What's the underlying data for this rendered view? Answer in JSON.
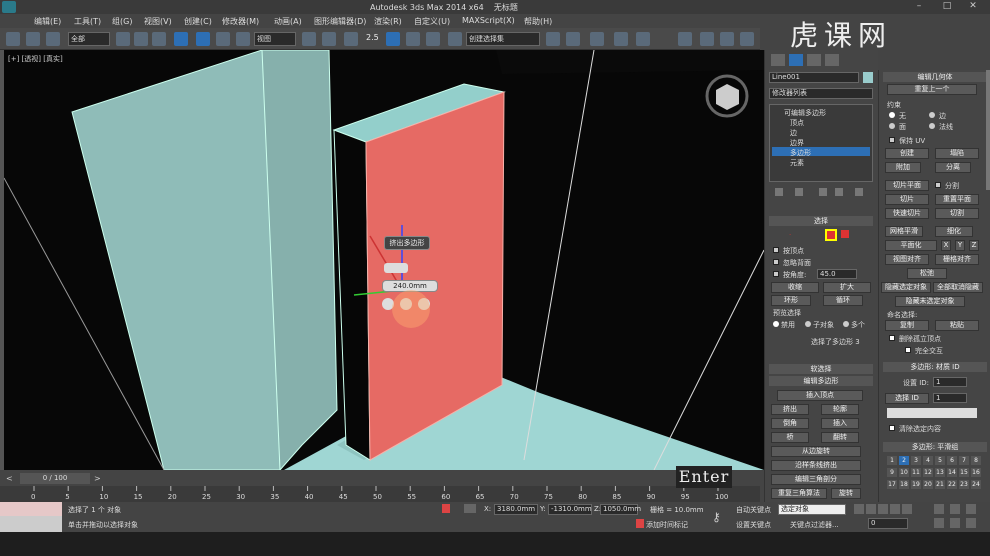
{
  "titlebar": {
    "app_title": "Autodesk 3ds Max  2014 x64",
    "doc_title": "无标题",
    "min": "–",
    "max": "□",
    "close": "✕"
  },
  "menu": [
    "编辑(E)",
    "工具(T)",
    "组(G)",
    "视图(V)",
    "创建(C)",
    "修改器(M)",
    "动画(A)",
    "图形编辑器(D)",
    "渲染(R)",
    "自定义(U)",
    "MAXScript(X)",
    "帮助(H)"
  ],
  "toolbar": {
    "filter": "全部",
    "refcoord": "视图",
    "snap": "2.5",
    "selset": "创建选择集"
  },
  "viewport": {
    "label": "[+] [透视] [真实]",
    "caddy_title": "挤出多边形",
    "caddy_value": "240.0mm"
  },
  "timeline": {
    "frame": "0 / 100",
    "ticks": [
      "0",
      "5",
      "10",
      "15",
      "20",
      "25",
      "30",
      "35",
      "40",
      "45",
      "50",
      "55",
      "60",
      "65",
      "70",
      "75",
      "80",
      "85",
      "90",
      "95",
      "100"
    ]
  },
  "status": {
    "selected": "选择了 1 个 对象",
    "hint": "单击并拖动以选择对象",
    "x": "3180.0mm",
    "y": "-1310.0mm",
    "z": "1050.0mm",
    "grid": "栅格 = 10.0mm",
    "autokey": "自动关键点",
    "setkey": "设置关键点",
    "sel_obj": "选定对象",
    "keyfilter": "关键点过滤器...",
    "addtime": "添加时间标记",
    "frame_field": "0"
  },
  "enter_overlay": "Enter",
  "watermark": "虎课网",
  "panel2": {
    "object_name": "Line001",
    "modlist": "修改器列表",
    "stack": [
      "可编辑多边形",
      "顶点",
      "边",
      "边界",
      "多边形",
      "元素"
    ],
    "select_hdr": "选择",
    "by_vertex": "按顶点",
    "ignore_back": "忽略背面",
    "by_angle": "按角度:",
    "angle_val": "45.0",
    "shrink": "收缩",
    "grow": "扩大",
    "ring": "环形",
    "loop": "循环",
    "preview_hdr": "预览选择",
    "disabled": "禁用",
    "subobj": "子对象",
    "multi": "多个",
    "sel_info": "选择了多边形 3",
    "soft_hdr": "软选择",
    "edit_poly_hdr": "编辑多边形",
    "insert_vertex": "插入顶点",
    "extrude": "挤出",
    "outline": "轮廓",
    "bevel": "倒角",
    "inset": "插入",
    "bridge": "桥",
    "flip": "翻转",
    "hinge": "从边旋转",
    "extrude_spline": "沿样条线挤出",
    "edit_tri": "编辑三角剖分",
    "retri": "重复三角算法",
    "turn": "旋转"
  },
  "panel3": {
    "edit_geo_hdr": "编辑几何体",
    "repeat": "重复上一个",
    "constraints": "约束",
    "none": "无",
    "edge": "边",
    "face": "面",
    "normal": "法线",
    "preserve_uv": "保持 UV",
    "create": "创建",
    "collapse": "塌陷",
    "attach": "附加",
    "detach": "分离",
    "slice_plane": "切片平面",
    "split": "分割",
    "slice": "切片",
    "reset_plane": "重置平面",
    "quickslice": "快速切片",
    "cut": "切割",
    "msmooth": "网格平滑",
    "tessellate": "细化",
    "planarize": "平面化",
    "x": "X",
    "y": "Y",
    "z": "Z",
    "view_align": "视图对齐",
    "grid_align": "栅格对齐",
    "relax": "松弛",
    "hide_sel": "隐藏选定对象",
    "unhide_all": "全部取消隐藏",
    "hide_unsel": "隐藏未选定对象",
    "named_sel": "命名选择:",
    "copy": "复制",
    "paste": "粘贴",
    "del_iso": "删除孤立顶点",
    "full_inter": "完全交互",
    "mat_hdr": "多边形: 材质 ID",
    "set_id": "设置 ID:",
    "set_id_val": "1",
    "sel_id": "选择 ID",
    "sel_id_val": "1",
    "clear_sel": "清除选定内容",
    "smooth_hdr": "多边形: 平滑组",
    "groups": [
      "1",
      "2",
      "3",
      "4",
      "5",
      "6",
      "7",
      "8",
      "9",
      "10",
      "11",
      "12",
      "13",
      "14",
      "15",
      "16",
      "17",
      "18",
      "19",
      "20",
      "21",
      "22",
      "23",
      "24"
    ]
  }
}
